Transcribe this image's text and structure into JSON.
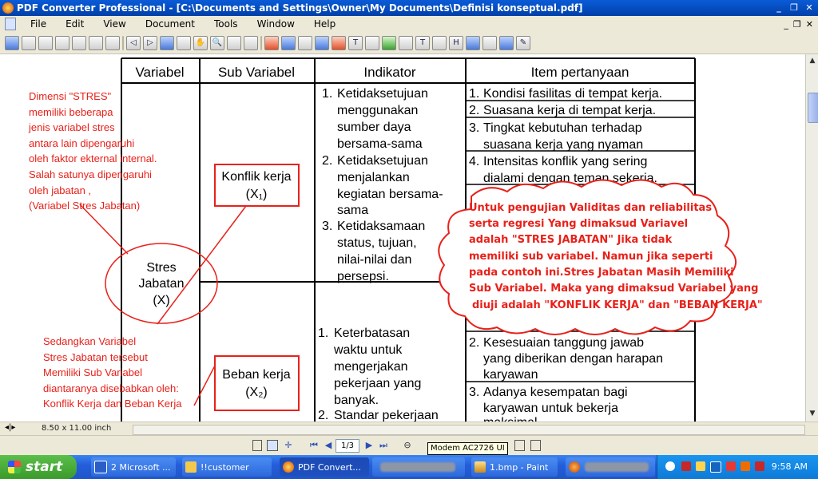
{
  "window": {
    "title": "PDF Converter Professional - [C:\\Documents and Settings\\Owner\\My Documents\\Definisi konseptual.pdf]"
  },
  "menu": [
    "File",
    "Edit",
    "View",
    "Document",
    "Tools",
    "Window",
    "Help"
  ],
  "table": {
    "headers": [
      "Variabel",
      "Sub Variabel",
      "Indikator",
      "Item pertanyaan"
    ],
    "variable": [
      "Stres",
      "Jabatan",
      "(X)"
    ],
    "sub1": [
      "Konflik kerja",
      "(X₁)"
    ],
    "sub2": [
      "Beban kerja",
      "(X₂)"
    ],
    "indikator1": [
      [
        "1.",
        "Ketidaksetujuan",
        "menggunakan",
        "sumber daya",
        "bersama-sama"
      ],
      [
        "2.",
        "Ketidaksetujuan",
        "menjalankan",
        "kegiatan bersama-",
        "sama"
      ],
      [
        "3.",
        "Ketidaksamaan",
        "status, tujuan,",
        "nilai-nilai dan",
        "persepsi."
      ]
    ],
    "indikator2": [
      [
        "1.",
        "Keterbatasan",
        "waktu untuk",
        "mengerjakan",
        "pekerjaan yang",
        "banyak."
      ],
      [
        "2.",
        "Standar pekerjaan"
      ]
    ],
    "items1": [
      [
        "1.",
        "Kondisi fasilitas di tempat kerja."
      ],
      [
        "2.",
        "Suasana kerja di tempat kerja."
      ],
      [
        "3.",
        "Tingkat kebutuhan terhadap",
        "suasana kerja yang nyaman"
      ],
      [
        "4.",
        "Intensitas konflik yang sering",
        "dialami dengan teman sekerja."
      ]
    ],
    "items2": [
      [
        "2.",
        "Kesesuaian tanggung jawab",
        "yang diberikan dengan harapan",
        "karyawan"
      ],
      [
        "3.",
        "Adanya kesempatan bagi",
        "karyawan untuk bekerja",
        "maksimal"
      ]
    ]
  },
  "annotations": {
    "left_top": [
      "Dimensi \"STRES\"",
      "memiliki beberapa",
      "jenis variabel stres",
      "antara lain dipengaruhi",
      "oleh faktor ekternal internal.",
      "Salah satunya dipengaruhi",
      "oleh jabatan ,",
      "(Variabel Stres Jabatan)"
    ],
    "left_bottom": [
      "Sedangkan Variabel",
      "Stres Jabatan tersebut",
      "Memiliki Sub Variabel",
      "diantaranya disebabkan oleh:",
      "Konflik Kerja dan Beban Kerja"
    ],
    "cloud": [
      "Untuk pengujian Validitas dan reliabilitas",
      "serta regresi Yang dimaksud Variavel",
      "adalah \"STRES JABATAN\" Jika tidak",
      "memiliki sub variabel. Namun jika seperti",
      "pada contoh ini.Stres Jabatan Masih Memiliki",
      "Sub Variabel. Maka yang dimaksud Variabel yang",
      "diuji adalah \"KONFLIK KERJA\" dan \"BEBAN KERJA\""
    ]
  },
  "status": {
    "page_size": "8.50 x 11.00 inch",
    "page": "1/3"
  },
  "tooltip": "Modem AC2726 UI",
  "taskbar": {
    "start": "start",
    "tasks": [
      "2 Microsoft ...",
      "!!customer",
      "PDF Convert...",
      "",
      "1.bmp - Paint"
    ],
    "clock": "9:58 AM"
  },
  "colors": {
    "annotation": "#e8211a",
    "titlebar": "#0a5bd8",
    "taskbar": "#245edb"
  }
}
